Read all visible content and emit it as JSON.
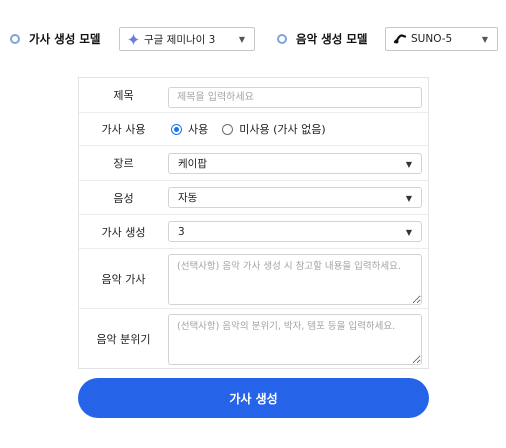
{
  "model_bar": {
    "lyrics_model": {
      "label": "가사 생성 모델",
      "selected": "구글 제미나이 3",
      "icon": "gemini-sparkle-icon"
    },
    "music_model": {
      "label": "음악 생성 모델",
      "selected": "SUNO-5",
      "icon": "suno-logo-icon"
    }
  },
  "form": {
    "title": {
      "label": "제목",
      "value": "",
      "placeholder": "제목을 입력하세요"
    },
    "lyrics_usage": {
      "label": "가사 사용",
      "options": [
        "사용",
        "미사용 (가사 없음)"
      ],
      "selected": "사용"
    },
    "genre": {
      "label": "장르",
      "selected": "케이팝"
    },
    "voice": {
      "label": "음성",
      "selected": "자동"
    },
    "lyrics_count": {
      "label": "가사 생성",
      "selected": "3"
    },
    "music_lyrics": {
      "label": "음악 가사",
      "value": "",
      "placeholder": "(선택사항) 음악 가사 생성 시 참고할 내용을 입력하세요."
    },
    "music_mood": {
      "label": "음악 분위기",
      "value": "",
      "placeholder": "(선택사항) 음악의 분위기, 박자, 템포 등을 입력하세요."
    }
  },
  "submit": {
    "label": "가사 생성"
  },
  "colors": {
    "accent": "#2563e8",
    "radio_checked": "#1a73e8",
    "gemini_gradient": [
      "#4285f4",
      "#9b72cb"
    ],
    "section_ring": "#7fa4dc"
  }
}
